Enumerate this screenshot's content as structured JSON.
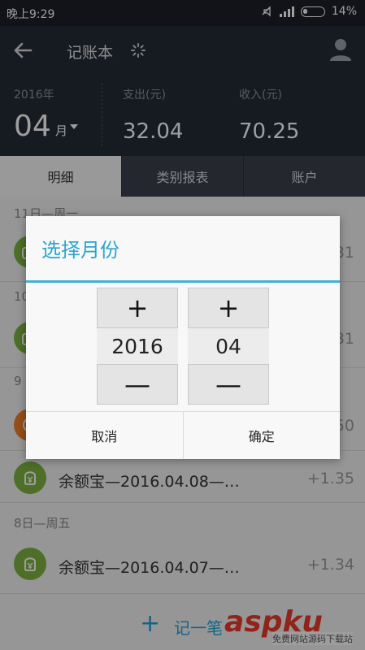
{
  "status_bar": {
    "time": "晚上9:29",
    "battery": "14%"
  },
  "header": {
    "title": "记账本",
    "year_label": "2016年",
    "month": "04",
    "month_unit": "月",
    "expense_label": "支出(元)",
    "expense_value": "32.04",
    "income_label": "收入(元)",
    "income_value": "70.25"
  },
  "tabs": [
    {
      "label": "明细"
    },
    {
      "label": "类别报表"
    },
    {
      "label": "账户"
    }
  ],
  "list": {
    "day_headers": [
      "11日—周一",
      "10",
      "9",
      "8日—周五"
    ],
    "rows": [
      {
        "amount": "31"
      },
      {
        "amount": "31"
      },
      {
        "amount": "50"
      },
      {
        "title": "余额宝—2016.04.08—…",
        "amount": "+1.35"
      },
      {
        "title": "余额宝—2016.04.07—…",
        "amount": "+1.34"
      }
    ]
  },
  "add_bar": {
    "plus": "+",
    "label": "记一笔"
  },
  "watermark": {
    "logo": "aspku",
    "caption": "免费网站源码下载站"
  },
  "dialog": {
    "title": "选择月份",
    "year_value": "2016",
    "month_value": "04",
    "plus_label": "+",
    "minus_label": "—",
    "cancel_label": "取消",
    "confirm_label": "确定"
  },
  "colors": {
    "accent": "#2ba5cf",
    "header_bg": "#252a36",
    "icon_green": "#7cb342",
    "icon_orange": "#f0802a"
  }
}
